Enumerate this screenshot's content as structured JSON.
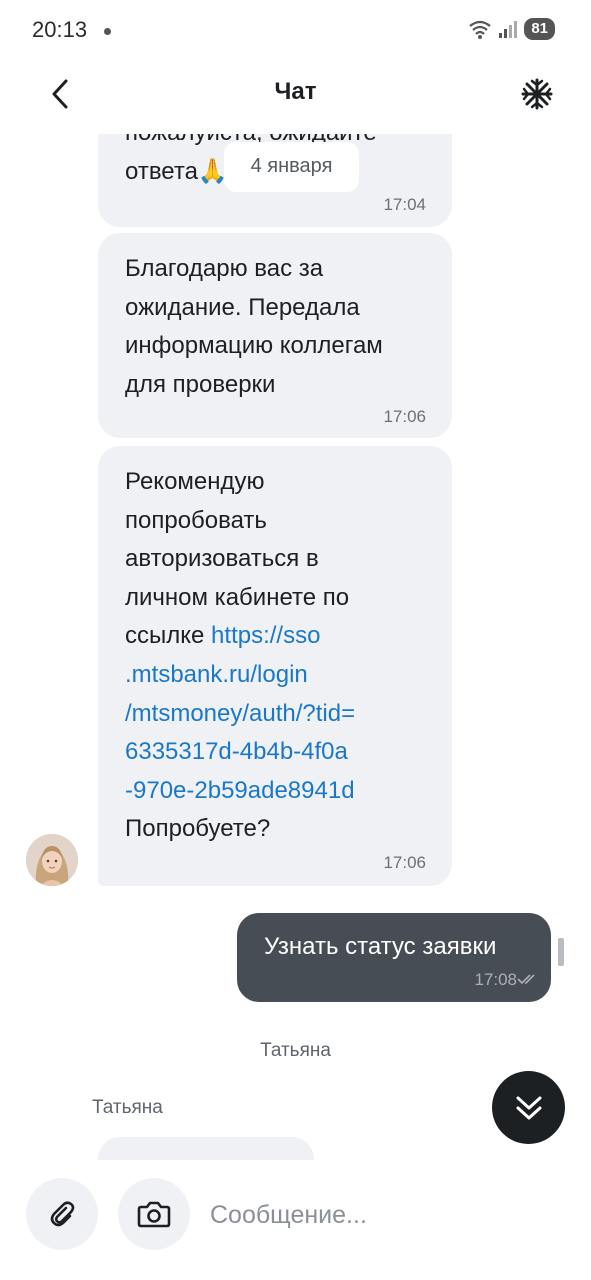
{
  "status_bar": {
    "time": "20:13",
    "battery": "81"
  },
  "header": {
    "title": "Чат"
  },
  "date_divider": "4 января",
  "messages": [
    {
      "lines": [
        "пожалуйста, ожидайте",
        "ответа🙏"
      ],
      "time": "17:04"
    },
    {
      "lines": [
        "Благодарю вас за",
        "ожидание. Передала",
        "информацию коллегам",
        "для проверки"
      ],
      "time": "17:06"
    },
    {
      "lines_before_link": [
        "Рекомендую",
        "попробовать",
        "авторизоваться в",
        "личном кабинете по"
      ],
      "link_prefix": "ссылке ",
      "link_lines": [
        "https://sso",
        ".mtsbank.ru/login",
        "/mtsmoney/auth/?tid=",
        "6335317d-4b4b-4f0a",
        "-970e-2b59ade8941d"
      ],
      "after_link": "Попробуете?",
      "time": "17:06"
    }
  ],
  "outgoing": {
    "text": "Узнать статус заявки",
    "time": "17:08"
  },
  "typing": {
    "center_name": "Татьяна",
    "left_name": "Татьяна"
  },
  "composer": {
    "placeholder": "Сообщение..."
  },
  "colors": {
    "incoming_bubble": "#eff1f5",
    "outgoing_bubble": "#474d54",
    "link": "#1b78c8",
    "fab": "#1d2023"
  }
}
